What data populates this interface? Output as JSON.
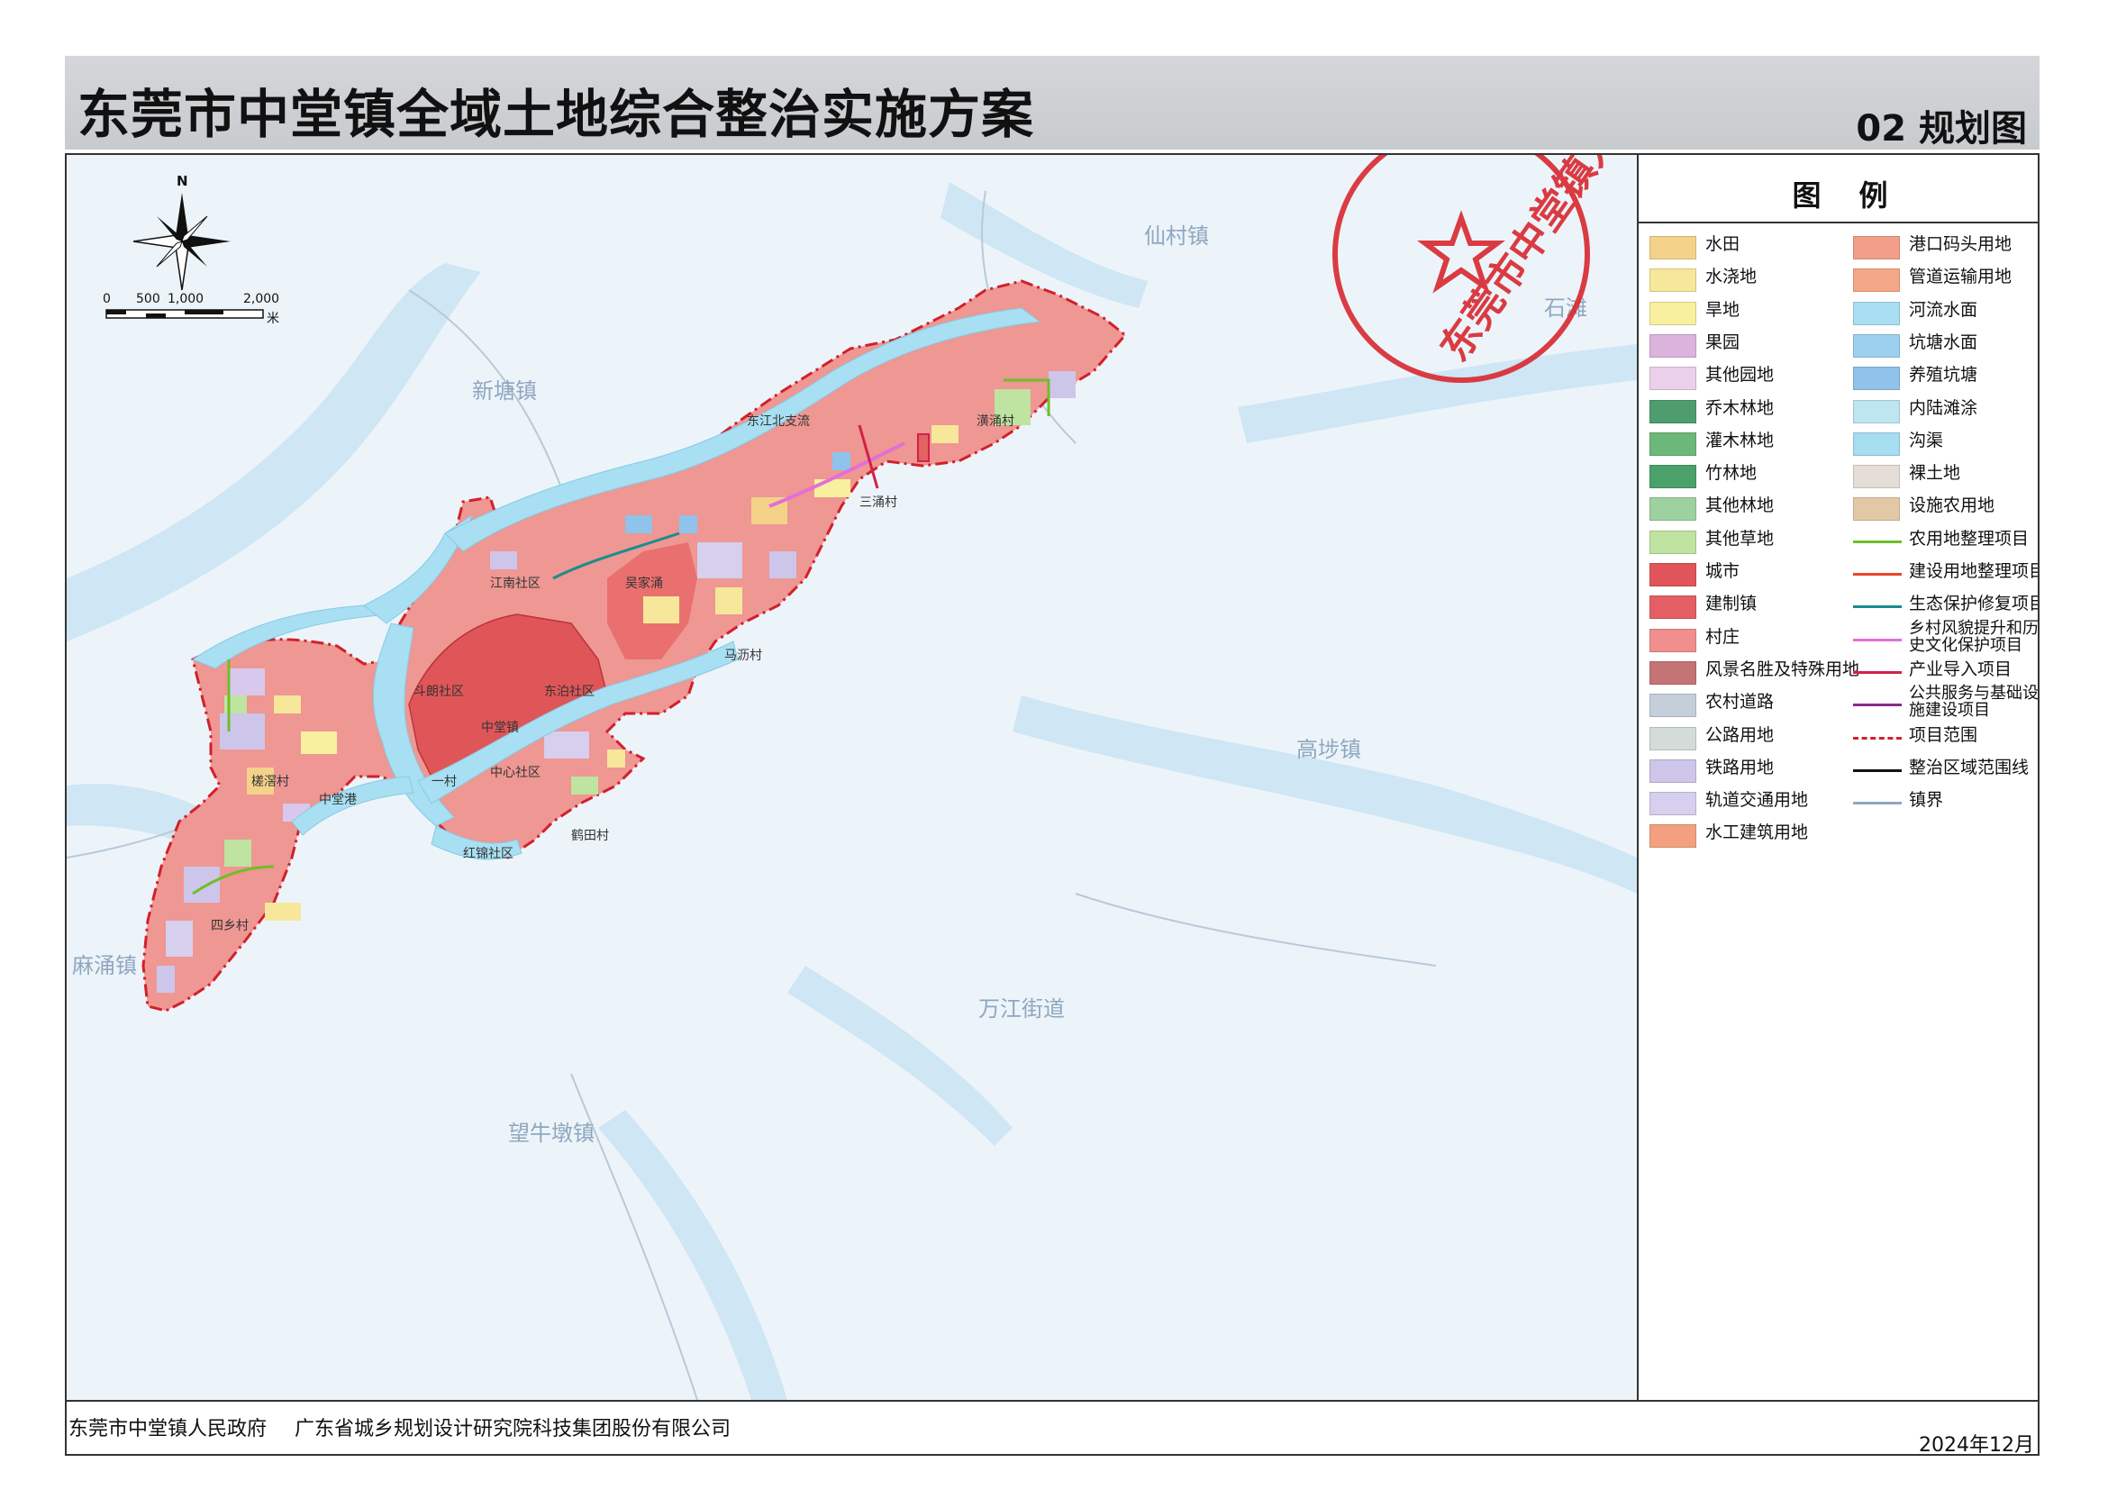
{
  "header": {
    "title": "东莞市中堂镇全域土地综合整治实施方案",
    "sheet_code": "02 规划图"
  },
  "map": {
    "north_label": "N",
    "scale": {
      "ticks": [
        "0",
        "500",
        "1,000",
        "2,000"
      ],
      "unit": "米"
    },
    "neighbor_towns": [
      "仙村镇",
      "新塘镇",
      "石滩",
      "高埗镇",
      "麻涌镇",
      "万江街道",
      "望牛墩镇"
    ],
    "village_labels": [
      "江南社区",
      "东江北支流",
      "东泊社区",
      "斗朗社区",
      "中心社区",
      "槎滘村",
      "中堂港",
      "红锦社区",
      "吴家涌",
      "三涌村",
      "潢涌村",
      "马沥村",
      "四乡村",
      "鹤田村",
      "一村",
      "中堂镇"
    ],
    "seal_text": "东莞市中堂镇人民政府",
    "colors": {
      "river": "#a9dcee",
      "city": "#e36b6b",
      "town": "#ee8c88",
      "village": "#f2a19c",
      "boundary": "#d2202a"
    }
  },
  "legend": {
    "title": "图例",
    "col1": [
      {
        "label": "水田",
        "color": "#f4d28a"
      },
      {
        "label": "水浇地",
        "color": "#f7e79a"
      },
      {
        "label": "旱地",
        "color": "#f8f09e"
      },
      {
        "label": "果园",
        "color": "#dcb3dd"
      },
      {
        "label": "其他园地",
        "color": "#ead0ea"
      },
      {
        "label": "乔木林地",
        "color": "#4f9d6e"
      },
      {
        "label": "灌木林地",
        "color": "#6cb87a"
      },
      {
        "label": "竹林地",
        "color": "#4aa16a"
      },
      {
        "label": "其他林地",
        "color": "#9dd2a0"
      },
      {
        "label": "其他草地",
        "color": "#bfe3a0"
      },
      {
        "label": "城市",
        "color": "#e0545a"
      },
      {
        "label": "建制镇",
        "color": "#e35f64"
      },
      {
        "label": "村庄",
        "color": "#f08f8d"
      },
      {
        "label": "风景名胜及特殊用地",
        "color": "#c47474"
      },
      {
        "label": "农村道路",
        "color": "#c5cfdb"
      },
      {
        "label": "公路用地",
        "color": "#d3dcd8"
      },
      {
        "label": "铁路用地",
        "color": "#cdc6ea"
      },
      {
        "label": "轨道交通用地",
        "color": "#d6cfee"
      },
      {
        "label": "水工建筑用地",
        "color": "#f2a07f"
      }
    ],
    "col2": [
      {
        "label": "港口码头用地",
        "color": "#f29e8a",
        "kind": "fill"
      },
      {
        "label": "管道运输用地",
        "color": "#f4a888",
        "kind": "fill"
      },
      {
        "label": "河流水面",
        "color": "#a8dff2",
        "kind": "fill"
      },
      {
        "label": "坑塘水面",
        "color": "#9dd0ef",
        "kind": "fill"
      },
      {
        "label": "养殖坑塘",
        "color": "#8fc3ec",
        "kind": "fill"
      },
      {
        "label": "内陆滩涂",
        "color": "#bde6f1",
        "kind": "fill"
      },
      {
        "label": "沟渠",
        "color": "#a6ddf0",
        "kind": "fill"
      },
      {
        "label": "裸土地",
        "color": "#e5ded6",
        "kind": "fill"
      },
      {
        "label": "设施农用地",
        "color": "#e3c8a6",
        "kind": "fill"
      },
      {
        "label": "农用地整理项目",
        "color": "#6fbe2a",
        "kind": "line"
      },
      {
        "label": "建设用地整理项目",
        "color": "#e8452c",
        "kind": "line"
      },
      {
        "label": "生态保护修复项目",
        "color": "#1a8c8c",
        "kind": "line"
      },
      {
        "label": "乡村风貌提升和历史文化保护项目",
        "color": "#e36fd6",
        "kind": "line"
      },
      {
        "label": "产业导入项目",
        "color": "#d2204a",
        "kind": "line"
      },
      {
        "label": "公共服务与基础设施建设项目",
        "color": "#8a2a8a",
        "kind": "line"
      },
      {
        "label": "项目范围",
        "color": "#d2202a",
        "kind": "dash"
      },
      {
        "label": "整治区域范围线",
        "color": "#111111",
        "kind": "line"
      },
      {
        "label": "镇界",
        "color": "#8fa7bf",
        "kind": "line"
      }
    ]
  },
  "footer": {
    "org1": "东莞市中堂镇人民政府",
    "org2": "广东省城乡规划设计研究院科技集团股份有限公司",
    "date": "2024年12月"
  }
}
